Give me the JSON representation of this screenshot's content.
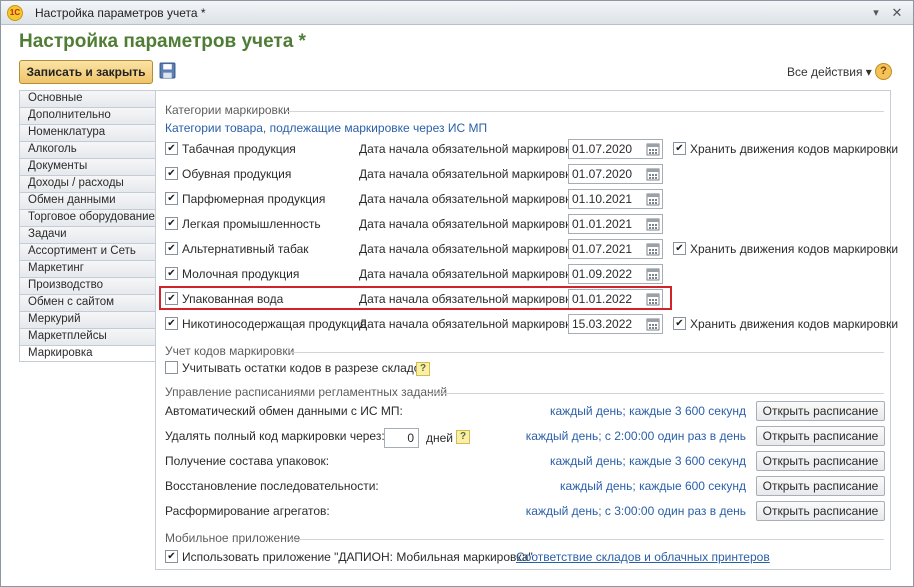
{
  "window": {
    "title": "Настройка параметров учета *",
    "logo_text": "1С"
  },
  "header": {
    "page_title": "Настройка параметров учета *",
    "save_close": "Записать и закрыть",
    "all_actions": "Все действия ▾",
    "help": "?"
  },
  "sidebar": {
    "items": [
      {
        "label": "Основные"
      },
      {
        "label": "Дополнительно"
      },
      {
        "label": "Номенклатура"
      },
      {
        "label": "Алкоголь"
      },
      {
        "label": "Документы"
      },
      {
        "label": "Доходы / расходы"
      },
      {
        "label": "Обмен данными"
      },
      {
        "label": "Торговое оборудование"
      },
      {
        "label": "Задачи"
      },
      {
        "label": "Ассортимент и Сеть"
      },
      {
        "label": "Маркетинг"
      },
      {
        "label": "Производство"
      },
      {
        "label": "Обмен с сайтом"
      },
      {
        "label": "Меркурий"
      },
      {
        "label": "Маркетплейсы"
      },
      {
        "label": "Маркировка"
      }
    ],
    "active": "Маркировка"
  },
  "categories": {
    "group_title": "Категории маркировки",
    "subtitle": "Категории товара, подлежащие маркировке через ИС МП",
    "date_label": "Дата начала обязательной маркировки:",
    "keep_label": "Хранить движения кодов маркировки",
    "rows": [
      {
        "name": "Табачная продукция",
        "date": "01.07.2020",
        "keep": true
      },
      {
        "name": "Обувная продукция",
        "date": "01.07.2020"
      },
      {
        "name": "Парфюмерная продукция",
        "date": "01.10.2021"
      },
      {
        "name": "Легкая промышленность",
        "date": "01.01.2021"
      },
      {
        "name": "Альтернативный табак",
        "date": "01.07.2021",
        "keep": true
      },
      {
        "name": "Молочная продукция",
        "date": "01.09.2022"
      },
      {
        "name": "Упакованная вода",
        "date": "01.01.2022"
      },
      {
        "name": "Никотиносодержащая продукция",
        "date": "15.03.2022",
        "keep": true
      }
    ]
  },
  "codes": {
    "group_title": "Учет кодов маркировки",
    "by_warehouse": "Учитывать остатки кодов в разрезе складов"
  },
  "schedules": {
    "group_title": "Управление расписаниями регламентных заданий",
    "button_label": "Открыть расписание",
    "days_label": "дней",
    "days_value": "0",
    "rows": [
      {
        "label": "Автоматический обмен данными с ИС МП:",
        "schedule": "каждый день; каждые 3 600 секунд"
      },
      {
        "label": "Удалять полный код маркировки через:",
        "schedule": "каждый день; с 2:00:00 один раз в день"
      },
      {
        "label": "Получение состава упаковок:",
        "schedule": "каждый день; каждые 3 600 секунд"
      },
      {
        "label": "Восстановление последовательности:",
        "schedule": "каждый день; каждые 600 секунд"
      },
      {
        "label": "Расформирование агрегатов:",
        "schedule": "каждый день; с 3:00:00 один раз в день"
      }
    ]
  },
  "mobile": {
    "group_title": "Мобильное приложение",
    "use_app": "Использовать приложение \"ДАПИОН: Мобильная маркировка\"",
    "mapping_link": "Соответствие складов и облачных принтеров"
  }
}
